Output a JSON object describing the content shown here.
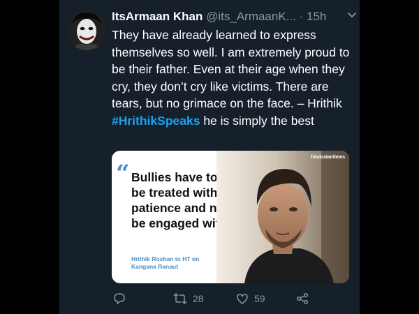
{
  "tweet": {
    "display_name": "ItsArmaan Khan",
    "handle": "@its_ArmaanK...",
    "separator": "·",
    "timestamp": "15h",
    "text_before": "They have already learned to express themselves so well. I am extremely proud to be their father. Even at their age when they cry, they don’t cry like victims. There are tears, but no grimace on the face. – Hrithik ",
    "hashtag": "#HrithikSpeaks",
    "text_after": " he is simply the best"
  },
  "card": {
    "quote_mark": "“",
    "quote": "Bullies have to be treated with patience and not be engaged with",
    "attribution": "Hrithik Roshan to HT on Kangana Ranaut",
    "brand": "hindustantimes"
  },
  "actions": {
    "reply_icon": "reply-icon",
    "retweet_icon": "retweet-icon",
    "retweet_count": "28",
    "like_icon": "heart-icon",
    "like_count": "59",
    "share_icon": "share-icon"
  },
  "colors": {
    "background": "#15202b",
    "accent": "#1da1f2",
    "muted": "#8899a6",
    "quote_accent": "#4a8fc9"
  }
}
